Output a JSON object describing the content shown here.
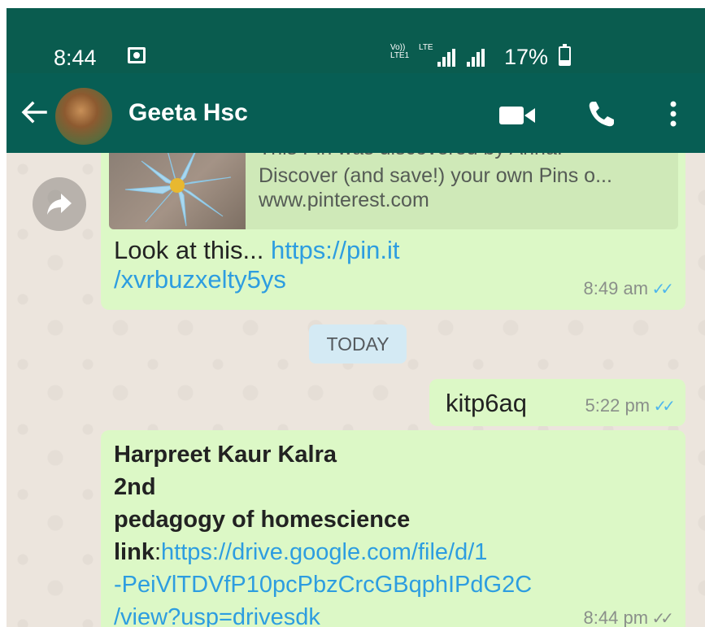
{
  "status_bar": {
    "time": "8:44",
    "volte": "Vo))",
    "lte1": "LTE1",
    "lte": "LTE",
    "battery": "17%"
  },
  "header": {
    "contact_name": "Geeta Hsc"
  },
  "messages": {
    "pin_message": {
      "preview_line_1": "This Pin was discovered by Anna.",
      "preview_line_2": "Discover (and save!) your own Pins o...",
      "preview_line_3": "www.pinterest.com",
      "text": "Look at this... ",
      "link_1": "https://pin.it",
      "link_2": "/xvrbuzxelty5ys",
      "time": "8:49 am"
    },
    "date_divider": "TODAY",
    "outgoing": {
      "text": "kitp6aq",
      "time": "5:22 pm"
    },
    "assignment": {
      "line_1": "Harpreet Kaur Kalra",
      "line_2": "2nd",
      "line_3": "pedagogy of homescience",
      "link_label": "link",
      "link_sep": ":",
      "link_1": "https://drive.google.com/file/d/1",
      "link_2": "-PeiVlTDVfP10pcPbzCrcGBqphIPdG2C",
      "link_3": "/view?usp=drivesdk",
      "time": "8:44 pm"
    }
  },
  "colors": {
    "header": "#075e54",
    "status_bar": "#0a5c4f",
    "bubble": "#dcf8c6",
    "chat_bg": "#ece5dd",
    "link": "#2d9de0",
    "read_ticks": "#4fb6ec"
  },
  "icons": [
    "back-arrow-icon",
    "video-call-icon",
    "voice-call-icon",
    "more-options-icon",
    "forward-icon",
    "double-check-icon",
    "gallery-icon",
    "signal-icon",
    "battery-icon"
  ]
}
